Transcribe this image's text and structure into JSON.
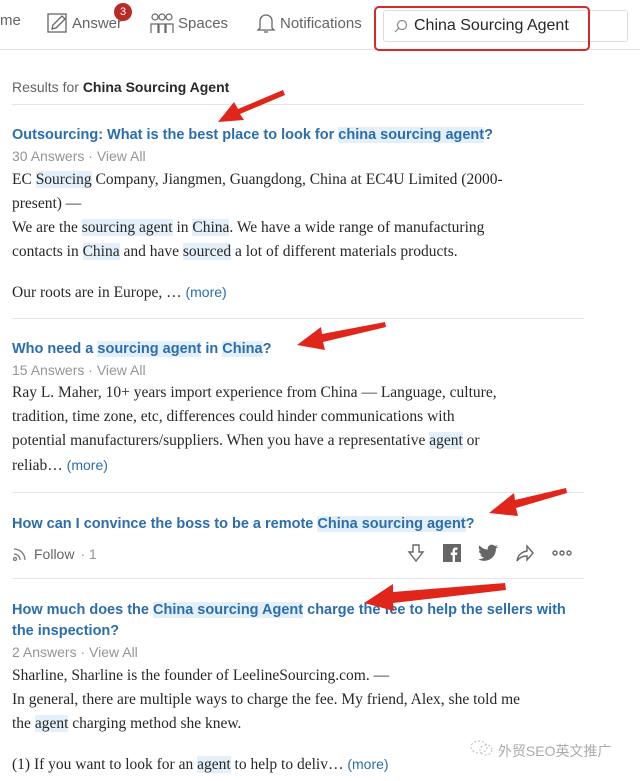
{
  "nav": {
    "home": "me",
    "answer": "Answer",
    "answer_badge": "3",
    "spaces": "Spaces",
    "notifications": "Notifications",
    "search_value": "China Sourcing Agent"
  },
  "results": {
    "prefix": "Results for ",
    "query": "China Sourcing Agent"
  },
  "questions": [
    {
      "title": [
        {
          "t": "Outsourcing: What is the best place to look for "
        },
        {
          "t": "china sourcing agent",
          "h": 1
        },
        {
          "t": "?"
        }
      ],
      "meta": "30 Answers · View All",
      "lines": [
        [
          {
            "t": "EC "
          },
          {
            "t": "Sourcing",
            "h": 1
          },
          {
            "t": " Company, Jiangmen, Guangdong, China at EC4U Limited (2000-"
          }
        ],
        [
          {
            "t": "present) —"
          }
        ],
        [
          {
            "t": "We are the "
          },
          {
            "t": "sourcing agent",
            "h": 1
          },
          {
            "t": " in "
          },
          {
            "t": "China",
            "h": 1
          },
          {
            "t": ". We have a wide range of manufacturing"
          }
        ],
        [
          {
            "t": "contacts in "
          },
          {
            "t": "China",
            "h": 1
          },
          {
            "t": " and have "
          },
          {
            "t": "sourced",
            "h": 1
          },
          {
            "t": " a lot of different materials products."
          }
        ],
        [],
        [
          {
            "t": "Our roots are in Europe, … "
          },
          {
            "t": "(more)",
            "m": 1
          }
        ]
      ]
    },
    {
      "title": [
        {
          "t": "Who need a "
        },
        {
          "t": "sourcing agent",
          "h": 1
        },
        {
          "t": " in "
        },
        {
          "t": "China",
          "h": 1
        },
        {
          "t": "?"
        }
      ],
      "meta": "15 Answers · View All",
      "lines": [
        [
          {
            "t": "Ray L. Maher, 10+ years import experience from China — Language, culture,"
          }
        ],
        [
          {
            "t": "tradition, time zone, etc, differences could hinder communications with"
          }
        ],
        [
          {
            "t": "potential manufacturers/suppliers. When you have a representative "
          },
          {
            "t": "agent",
            "h": 1
          },
          {
            "t": " or"
          }
        ],
        [
          {
            "t": "reliab… "
          },
          {
            "t": "(more)",
            "m": 1
          }
        ]
      ]
    },
    {
      "title": [
        {
          "t": "How can I convince the boss to be a remote "
        },
        {
          "t": "China sourcing agent",
          "h": 1
        },
        {
          "t": "?"
        }
      ],
      "follow": "Follow",
      "follow_count": "· 1",
      "lines": []
    },
    {
      "title": [
        {
          "t": "How much does the "
        },
        {
          "t": "China sourcing Agent",
          "h": 1
        },
        {
          "t": " charge the fee to help the sellers with the inspection?"
        }
      ],
      "meta": "2 Answers · View All",
      "lines": [
        [
          {
            "t": "Sharline, Sharline is the founder of LeelineSourcing.com. —"
          }
        ],
        [
          {
            "t": "In general, there are multiple ways to charge the fee. My friend, Alex, she told me"
          }
        ],
        [
          {
            "t": "the "
          },
          {
            "t": "agent",
            "h": 1
          },
          {
            "t": " charging method she knew."
          }
        ],
        [],
        [
          {
            "t": "(1) If you want to look for an "
          },
          {
            "t": "agent",
            "h": 1
          },
          {
            "t": " to help to deliv… "
          },
          {
            "t": "(more)",
            "m": 1
          }
        ]
      ]
    }
  ],
  "watermark": "外贸SEO英文推广",
  "colors": {
    "link": "#2b6dad",
    "highlight": "#e3f0fa",
    "arrow": "#e0251b",
    "badge": "#b92b27"
  }
}
